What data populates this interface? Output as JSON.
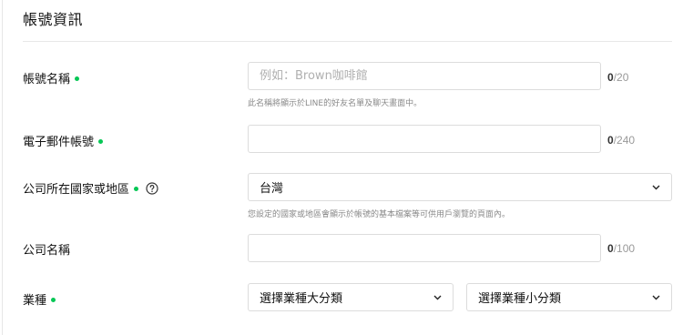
{
  "section": {
    "title": "帳號資訊"
  },
  "fields": {
    "account_name": {
      "label": "帳號名稱",
      "placeholder": "例如：Brown咖啡館",
      "value": "",
      "counter_current": "0",
      "counter_max": "/20",
      "hint": "此名稱將顯示於LINE的好友名單及聊天畫面中。"
    },
    "email": {
      "label": "電子郵件帳號",
      "value": "",
      "counter_current": "0",
      "counter_max": "/240"
    },
    "country": {
      "label": "公司所在國家或地區",
      "selected": "台灣",
      "hint": "您設定的國家或地區會顯示於帳號的基本檔案等可供用戶瀏覽的頁面內。"
    },
    "company_name": {
      "label": "公司名稱",
      "value": "",
      "counter_current": "0",
      "counter_max": "/100"
    },
    "industry": {
      "label": "業種",
      "major_selected": "選擇業種大分類",
      "minor_selected": "選擇業種小分類"
    }
  },
  "colors": {
    "required_dot": "#06c755",
    "border": "#dcdcdc",
    "hint": "#8a8a8a"
  },
  "icons": {
    "required": "required-dot-icon",
    "help": "help-circle-icon",
    "dropdown": "chevron-down-icon"
  }
}
